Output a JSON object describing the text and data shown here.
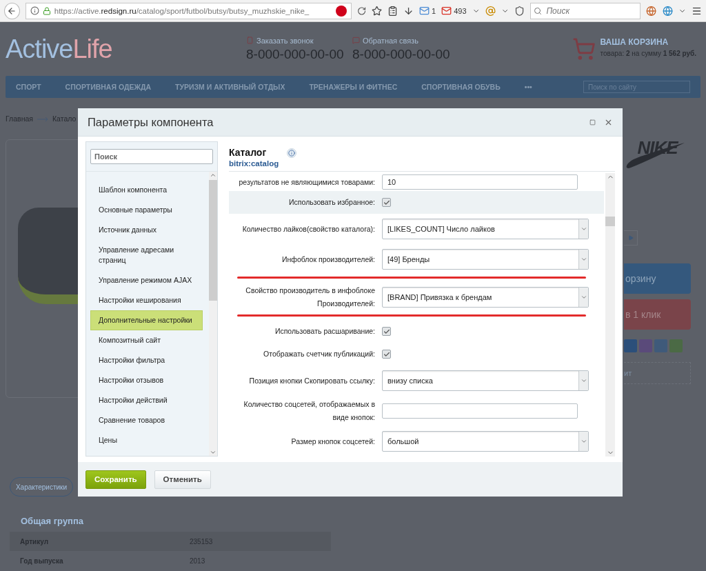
{
  "browser": {
    "url": "https://active.**redsign.ru**/catalog/sport/futbol/butsy/butsy_muzhskie_nike_",
    "mail_count": "1",
    "gmail_count": "493",
    "search": {
      "placeholder": "Поиск"
    }
  },
  "site": {
    "logo": {
      "first": "Active",
      "second": "Life"
    },
    "contacts": [
      {
        "kind": "phone",
        "label": "Заказать звонок",
        "phone": "8-000-000-00-00"
      },
      {
        "kind": "chat",
        "label": "Обратная связь",
        "phone": "8-000-000-00-00"
      }
    ],
    "cart": {
      "title": "ВАША КОРЗИНА",
      "summary": "товара: **2** на сумму **1 562 руб.**"
    },
    "nav": {
      "items": [
        "СПОРТ",
        "СПОРТИВНАЯ ОДЕЖДА",
        "ТУРИЗМ И АКТИВНЫЙ ОТДЫХ",
        "ТРЕНАЖЕРЫ И ФИТНЕС",
        "СПОРТИВНАЯ ОБУВЬ",
        "•••"
      ],
      "search_placeholder": "Поиск по сайту"
    },
    "breadcrumbs": [
      "Главная",
      "Катало"
    ],
    "brand_logo": "NIKE",
    "side_buttons": [
      {
        "kind": "cart",
        "label": "орзину"
      },
      {
        "kind": "oneclick",
        "label": "в 1 клик"
      }
    ],
    "dotted_link": "ит",
    "tab": "Характеристики",
    "specs": {
      "group": "Общая группа",
      "rows": [
        {
          "name": "Артикул",
          "value": "235153"
        },
        {
          "name": "Год выпуска",
          "value": "2013"
        }
      ]
    }
  },
  "dialog": {
    "title": "Параметры компонента",
    "search": {
      "placeholder": "Поиск"
    },
    "sections": [
      {
        "label": "Шаблон компонента",
        "selected": false
      },
      {
        "label": "Основные параметры",
        "selected": false
      },
      {
        "label": "Источник данных",
        "selected": false
      },
      {
        "label": "Управление адресами страниц",
        "selected": false
      },
      {
        "label": "Управление режимом AJAX",
        "selected": false
      },
      {
        "label": "Настройки кеширования",
        "selected": false
      },
      {
        "label": "Дополнительные настройки",
        "selected": true
      },
      {
        "label": "Композитный сайт",
        "selected": false
      },
      {
        "label": "Настройки фильтра",
        "selected": false
      },
      {
        "label": "Настройки отзывов",
        "selected": false
      },
      {
        "label": "Настройки действий",
        "selected": false
      },
      {
        "label": "Сравнение товаров",
        "selected": false
      },
      {
        "label": "Цены",
        "selected": false
      }
    ],
    "component": {
      "name": "Каталог",
      "code": "bitrix:catalog"
    },
    "params": [
      {
        "kind": "text",
        "label": "результатов не являющимися товарами:",
        "value": "10",
        "hover": false,
        "underlined": false
      },
      {
        "kind": "checkbox",
        "label": "Использовать избранное:",
        "checked": true,
        "hover": true,
        "underlined": false
      },
      {
        "kind": "select",
        "label": "Количество лайков(свойство каталога):",
        "value": "[LIKES_COUNT] Число лайков",
        "hover": false,
        "underlined": false
      },
      {
        "kind": "select",
        "label": "Инфоблок производителей:",
        "value": "[49] Бренды",
        "hover": false,
        "underlined": true
      },
      {
        "kind": "select",
        "label": "Свойство производитель в инфоблоке Производителей:",
        "value": "[BRAND] Привязка к брендам",
        "hover": false,
        "underlined": true
      },
      {
        "kind": "checkbox",
        "label": "Использовать расшаривание:",
        "checked": true,
        "hover": false,
        "underlined": false
      },
      {
        "kind": "checkbox",
        "label": "Отображать счетчик публикаций:",
        "checked": true,
        "hover": false,
        "underlined": false
      },
      {
        "kind": "select",
        "label": "Позиция кнопки Скопировать ссылку:",
        "value": "внизу списка",
        "hover": false,
        "underlined": false
      },
      {
        "kind": "text",
        "label": "Количество соцсетей, отображаемых в виде кнопок:",
        "hover": false,
        "underlined": false
      },
      {
        "kind": "select",
        "label": "Размер кнопок соцсетей:",
        "value": "большой",
        "hover": false,
        "underlined": false
      }
    ],
    "buttons": [
      {
        "kind": "primary",
        "label": "Сохранить"
      },
      {
        "kind": "secondary",
        "label": "Отменить"
      }
    ]
  }
}
